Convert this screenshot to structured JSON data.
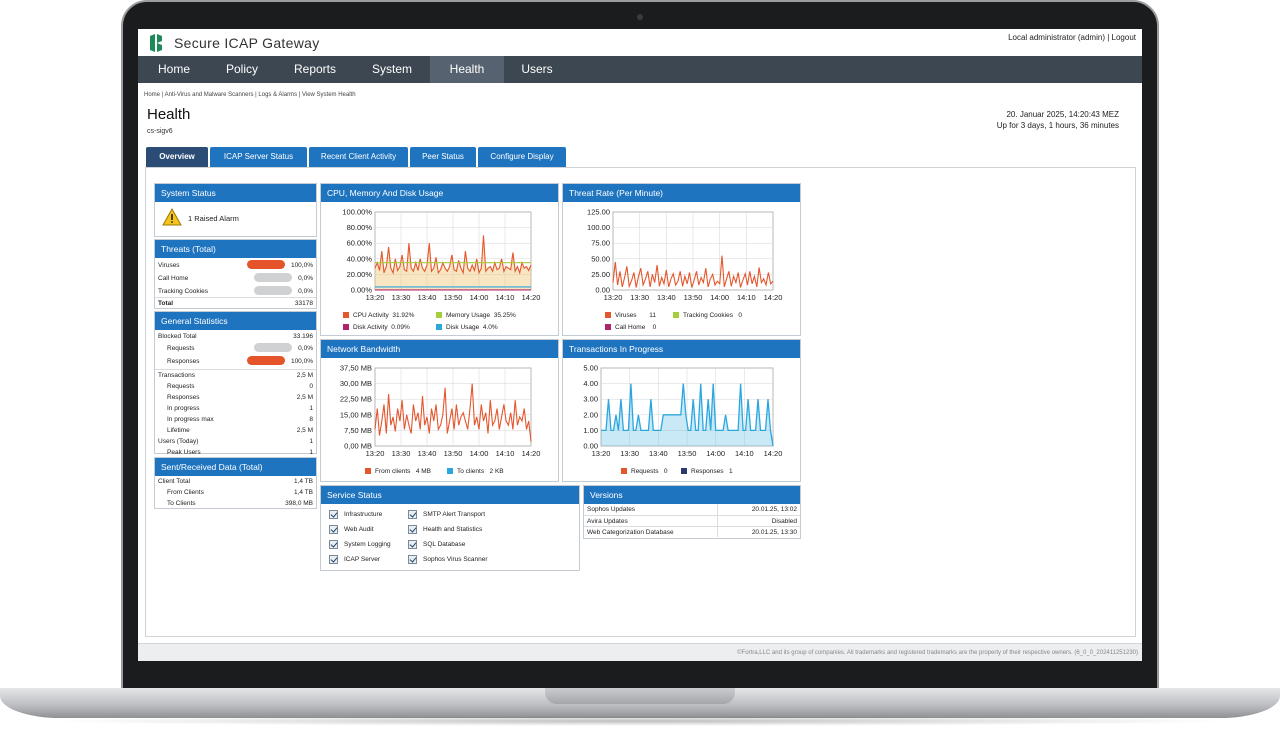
{
  "app": {
    "title": "Secure ICAP Gateway",
    "user": "Local administrator (admin)",
    "separator": " | ",
    "logout": "Logout"
  },
  "nav": [
    "Home",
    "Policy",
    "Reports",
    "System",
    "Health",
    "Users"
  ],
  "nav_active": "Health",
  "breadcrumb": "Home | Anti-Virus and Malware Scanners | Logs & Alarms | View System Health",
  "page": {
    "title": "Health",
    "host": "cs-sigv6",
    "date": "20. Januar 2025, 14:20:43 MEZ",
    "uptime": "Up for 3 days, 1 hours, 36 minutes"
  },
  "tabs": [
    "Overview",
    "ICAP Server Status",
    "Recent Client Activity",
    "Peer Status",
    "Configure Display"
  ],
  "system_status": {
    "title": "System Status",
    "alarm": "1 Raised Alarm"
  },
  "threats": {
    "title": "Threats (Total)",
    "rows": [
      {
        "label": "Viruses",
        "value": "100,0%",
        "level": 100
      },
      {
        "label": "Call Home",
        "value": "0,0%",
        "level": 0
      },
      {
        "label": "Tracking Cookies",
        "value": "0,0%",
        "level": 0
      }
    ],
    "total_label": "Total",
    "total_value": "33178"
  },
  "general": {
    "title": "General Statistics",
    "blocked_label": "Blocked Total",
    "blocked_value": "33.196",
    "blocked_requests_label": "Requests",
    "blocked_requests_value": "0,0%",
    "blocked_responses_label": "Responses",
    "blocked_responses_value": "100,0%",
    "rows": [
      {
        "label": "Transactions",
        "value": "2,5 M",
        "indent": false
      },
      {
        "label": "Requests",
        "value": "0",
        "indent": true
      },
      {
        "label": "Responses",
        "value": "2,5 M",
        "indent": true
      },
      {
        "label": "In progress",
        "value": "1",
        "indent": true
      },
      {
        "label": "In progress max",
        "value": "8",
        "indent": true
      },
      {
        "label": "Lifetime",
        "value": "2,5 M",
        "indent": true
      },
      {
        "label": "Users (Today)",
        "value": "1",
        "indent": false
      },
      {
        "label": "Peak Users",
        "value": "1",
        "indent": true
      }
    ]
  },
  "sent": {
    "title": "Sent/Received Data (Total)",
    "rows": [
      {
        "label": "Client Total",
        "value": "1,4 TB",
        "indent": false
      },
      {
        "label": "From Clients",
        "value": "1,4 TB",
        "indent": true
      },
      {
        "label": "To Clients",
        "value": "398,0 MB",
        "indent": true
      }
    ]
  },
  "chart_data": [
    {
      "type": "line",
      "title": "CPU, Memory And Disk Usage",
      "x": [
        "13:20",
        "13:30",
        "13:40",
        "13:50",
        "14:00",
        "14:10",
        "14:20"
      ],
      "yticks": [
        "100.00%",
        "80.00%",
        "60.00%",
        "40.00%",
        "20.00%",
        "0.00%"
      ],
      "ylim": [
        0,
        100
      ],
      "grid": true,
      "series": [
        {
          "name": "CPU Activity",
          "value_label": "31.92%",
          "color": "#e4572e",
          "values": [
            28,
            35,
            25,
            50,
            22,
            30,
            55,
            28,
            22,
            40,
            25,
            30,
            45,
            26,
            24,
            60,
            28,
            24,
            35,
            25,
            40,
            28,
            24,
            32,
            60,
            24,
            28,
            42,
            22,
            26,
            35,
            28,
            24,
            30,
            45,
            26,
            24,
            38,
            28,
            22,
            50,
            28,
            24,
            32,
            25,
            40,
            22,
            28,
            70,
            24,
            28,
            30,
            24,
            35,
            26,
            28,
            40,
            24,
            30,
            28,
            26,
            48,
            24,
            30,
            22,
            35,
            28,
            30,
            25,
            32
          ]
        },
        {
          "name": "Memory Usage",
          "value_label": "35.25%",
          "color": "#a6cd3c",
          "values": [
            35,
            35,
            35,
            35,
            35,
            35,
            35,
            35,
            35,
            35,
            35,
            35,
            35,
            35,
            35,
            35,
            35,
            35,
            35,
            35,
            35,
            35,
            35,
            35,
            35,
            35,
            35,
            35,
            35,
            35,
            35,
            35,
            35,
            35,
            35,
            35,
            35,
            35,
            35,
            35,
            35,
            35,
            35,
            35,
            35,
            35,
            35,
            35,
            35,
            35,
            35,
            35,
            35,
            35,
            35,
            35,
            35,
            35,
            35,
            35,
            35,
            35,
            35,
            35,
            35,
            35,
            35,
            35,
            35,
            35
          ]
        },
        {
          "name": "Disk Activity",
          "value_label": "0.09%",
          "color": "#b0246b",
          "values": [
            0.1,
            0.1,
            0.1,
            0.1,
            0.1,
            0.1,
            0.1,
            0.1,
            0.1,
            0.1
          ]
        },
        {
          "name": "Disk Usage",
          "value_label": "4.0%",
          "color": "#2aa7df",
          "values": [
            4,
            4,
            4,
            4,
            4,
            4,
            4,
            4,
            4,
            4
          ]
        }
      ]
    },
    {
      "type": "line",
      "title": "Threat Rate (Per Minute)",
      "x": [
        "13:20",
        "13:30",
        "13:40",
        "13:50",
        "14:00",
        "14:10",
        "14:20"
      ],
      "yticks": [
        "125.00",
        "100.00",
        "75.00",
        "50.00",
        "25.00",
        "0.00"
      ],
      "ylim": [
        0,
        125
      ],
      "grid": true,
      "series": [
        {
          "name": "Viruses",
          "value_label": "11",
          "color": "#e4572e",
          "values": [
            12,
            45,
            8,
            30,
            5,
            20,
            38,
            6,
            15,
            28,
            4,
            22,
            35,
            8,
            18,
            30,
            5,
            25,
            12,
            40,
            6,
            20,
            10,
            32,
            5,
            18,
            26,
            8,
            14,
            30,
            6,
            22,
            10,
            28,
            4,
            16,
            30,
            8,
            20,
            12,
            35,
            5,
            18,
            25,
            8,
            14,
            10,
            55,
            5,
            18,
            30,
            6,
            22,
            12,
            28,
            4,
            16,
            26,
            8,
            30,
            10,
            22,
            5,
            36,
            12,
            18,
            8,
            28,
            10,
            14
          ]
        },
        {
          "name": "Tracking Cookies",
          "value_label": "0",
          "color": "#a6cd3c",
          "values": []
        },
        {
          "name": "Call Home",
          "value_label": "0",
          "color": "#b0246b",
          "values": []
        }
      ]
    },
    {
      "type": "line",
      "title": "Network Bandwidth",
      "x": [
        "13:20",
        "13:30",
        "13:40",
        "13:50",
        "14:00",
        "14:10",
        "14:20"
      ],
      "yticks": [
        "37,50 MB",
        "30,00 MB",
        "22,50 MB",
        "15,00 MB",
        "7,50 MB",
        "0,00 MB"
      ],
      "ylim": [
        0,
        37.5
      ],
      "grid": true,
      "series": [
        {
          "name": "From clients",
          "value_label": "4 MB",
          "color": "#e4572e",
          "values": [
            8,
            18,
            5,
            12,
            20,
            6,
            25,
            10,
            14,
            7,
            18,
            12,
            22,
            8,
            15,
            10,
            6,
            20,
            12,
            16,
            8,
            24,
            10,
            14,
            6,
            18,
            12,
            20,
            8,
            10,
            15,
            28,
            6,
            12,
            18,
            8,
            20,
            10,
            14,
            16,
            12,
            8,
            18,
            30,
            10,
            14,
            8,
            20,
            12,
            16,
            6,
            22,
            10,
            12,
            18,
            8,
            14,
            20,
            12,
            10,
            16,
            8,
            22,
            10,
            14,
            12,
            18,
            8,
            12,
            2
          ]
        },
        {
          "name": "To clients",
          "value_label": "2 KB",
          "color": "#2aa7df",
          "values": []
        }
      ]
    },
    {
      "type": "area",
      "title": "Transactions In Progress",
      "x": [
        "13:20",
        "13:30",
        "13:40",
        "13:50",
        "14:00",
        "14:10",
        "14:20"
      ],
      "yticks": [
        "5.00",
        "4.00",
        "3.00",
        "2.00",
        "1.00",
        "0.00"
      ],
      "ylim": [
        0,
        5
      ],
      "grid": true,
      "series": [
        {
          "name": "Requests",
          "value_label": "0",
          "color": "#e4572e",
          "values": []
        },
        {
          "name": "Responses",
          "value_label": "1",
          "color": "#2aa7df",
          "values": [
            1,
            1,
            1,
            3,
            1,
            1,
            2,
            1,
            3,
            1,
            1,
            1,
            4,
            1,
            1,
            2,
            1,
            1,
            1,
            1,
            3,
            1,
            1,
            1,
            1,
            2,
            2,
            2,
            2,
            2,
            2,
            2,
            2,
            4,
            2,
            1,
            1,
            3,
            1,
            1,
            4,
            1,
            1,
            3,
            1,
            4,
            1,
            1,
            1,
            1,
            2,
            1,
            1,
            1,
            1,
            1,
            4,
            1,
            1,
            3,
            1,
            1,
            1,
            3,
            1,
            1,
            1,
            3,
            1,
            0
          ]
        }
      ]
    }
  ],
  "services": {
    "title": "Service Status",
    "left": [
      "Infrastructure",
      "Web Audit",
      "System Logging",
      "ICAP Server"
    ],
    "right": [
      "SMTP Alert Transport",
      "Health and Statistics",
      "SQL Database",
      "Sophos Virus Scanner"
    ]
  },
  "versions": {
    "title": "Versions",
    "rows": [
      {
        "label": "Sophos Updates",
        "value": "20.01.25, 13:02"
      },
      {
        "label": "Avira Updates",
        "value": "Disabled"
      },
      {
        "label": "Web Categorization Database",
        "value": "20.01.25, 13:30"
      }
    ]
  },
  "footer": "©Fortra,LLC and its group of companies. All trademarks and registered trademarks are the property of their respective owners. (6_0_0_202411251230)",
  "colors": {
    "accent": "#1f74c0",
    "nav": "#3c4751",
    "alert": "#e4532a"
  }
}
